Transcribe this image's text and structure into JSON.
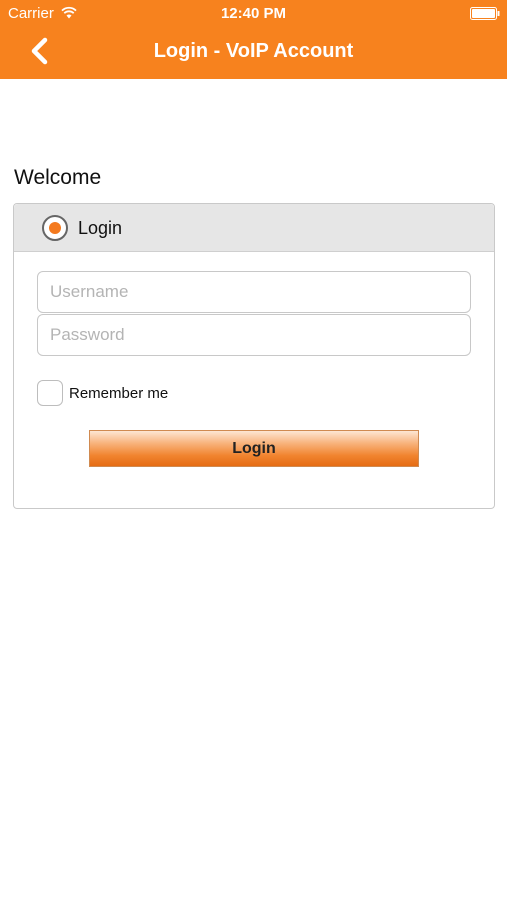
{
  "status_bar": {
    "carrier": "Carrier",
    "time": "12:40 PM"
  },
  "nav": {
    "title": "Login - VoIP Account",
    "back_icon": "chevron-left-icon"
  },
  "welcome_text": "Welcome",
  "login_panel": {
    "option_label": "Login",
    "option_selected": true,
    "username_placeholder": "Username",
    "password_placeholder": "Password",
    "remember_label": "Remember me",
    "remember_checked": false,
    "submit_label": "Login"
  },
  "colors": {
    "accent": "#f7821e",
    "radio_dot": "#f47a1f"
  }
}
